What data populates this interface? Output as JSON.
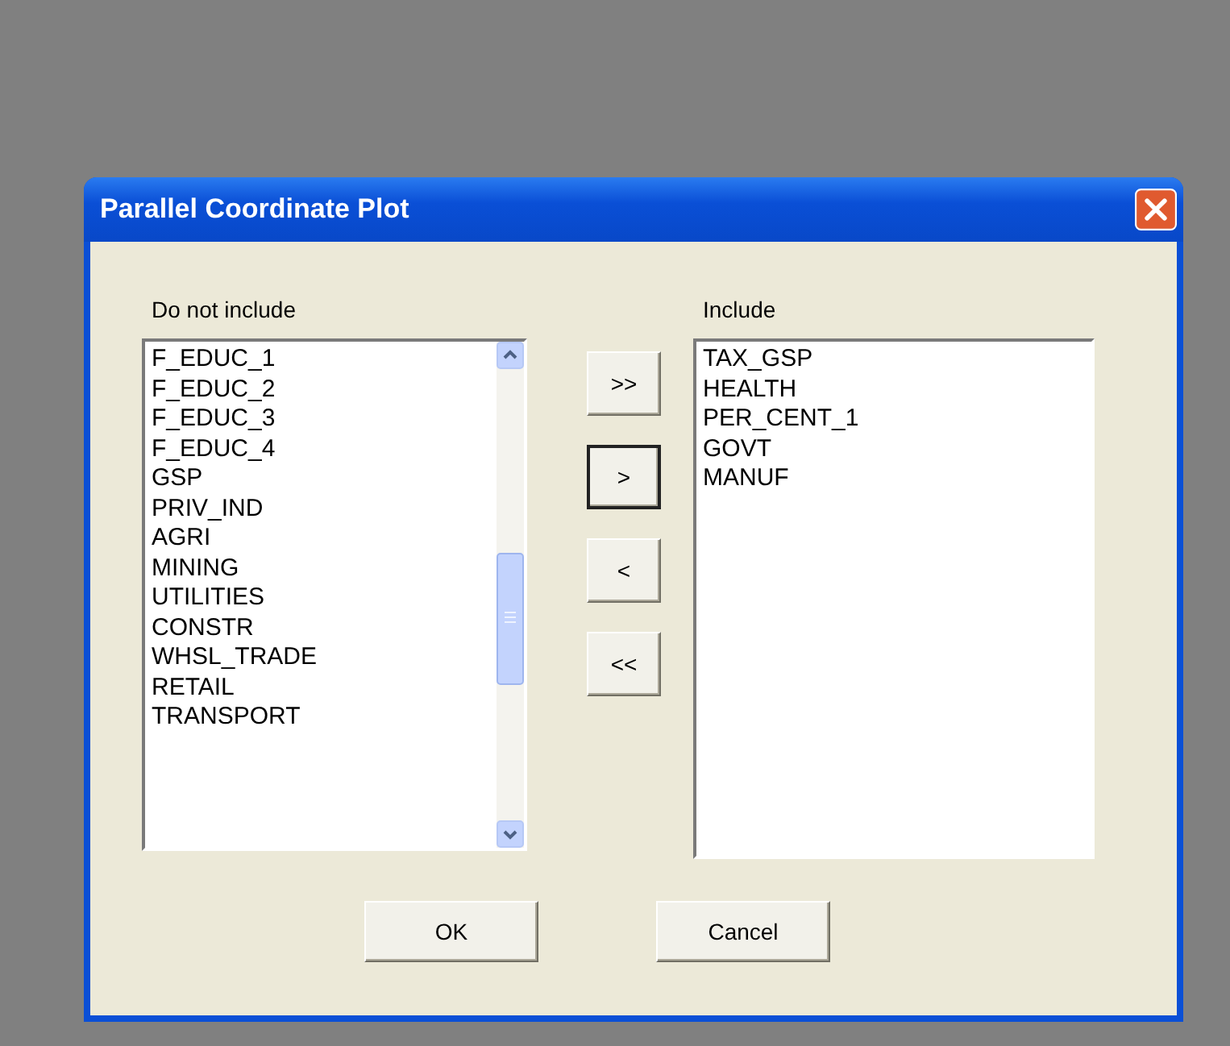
{
  "window": {
    "title": "Parallel Coordinate Plot"
  },
  "excluded": {
    "label": "Do not include",
    "items": [
      "F_EDUC_1",
      "F_EDUC_2",
      "F_EDUC_3",
      "F_EDUC_4",
      "GSP",
      "PRIV_IND",
      "AGRI",
      "MINING",
      "UTILITIES",
      "CONSTR",
      "WHSL_TRADE",
      "RETAIL",
      "TRANSPORT"
    ]
  },
  "move_buttons": [
    {
      "label": ">>",
      "focused": false
    },
    {
      "label": ">",
      "focused": true
    },
    {
      "label": "<",
      "focused": false
    },
    {
      "label": "<<",
      "focused": false
    }
  ],
  "included": {
    "label": "Include",
    "items": [
      "TAX_GSP",
      "HEALTH",
      "PER_CENT_1",
      "GOVT",
      "MANUF"
    ]
  },
  "buttons": [
    "OK",
    "Cancel"
  ]
}
